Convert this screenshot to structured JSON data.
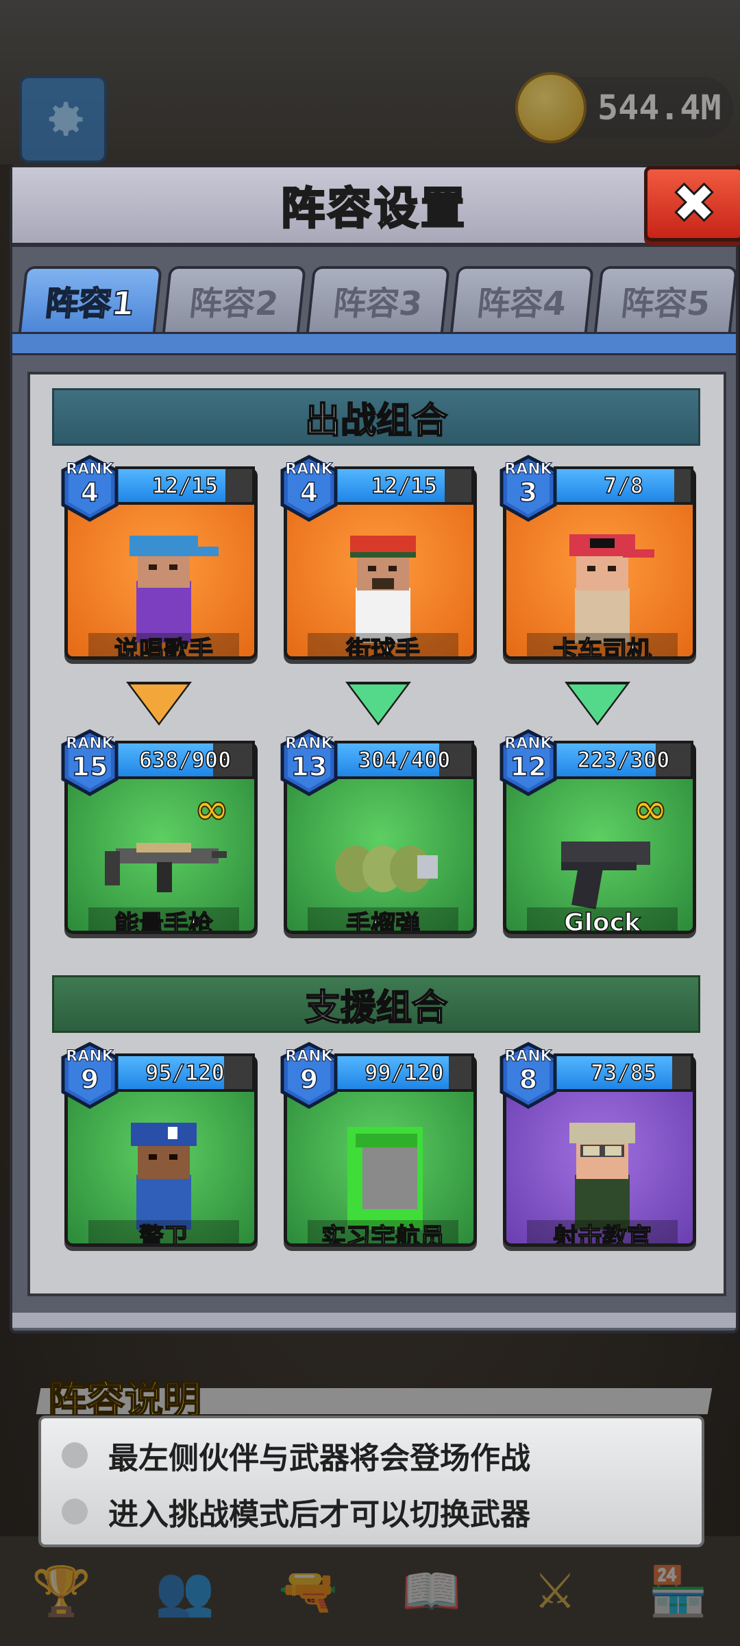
{
  "hud": {
    "coins": "544.4M"
  },
  "dialog": {
    "title": "阵容设置",
    "close_label": "✖",
    "tabs": [
      {
        "label": "阵容1",
        "active": true
      },
      {
        "label": "阵容2",
        "active": false
      },
      {
        "label": "阵容3",
        "active": false
      },
      {
        "label": "阵容4",
        "active": false
      },
      {
        "label": "阵容5",
        "active": false
      }
    ]
  },
  "battle_section": {
    "title": "出战组合",
    "partners": [
      {
        "rank_label": "RANK",
        "rank": "4",
        "progress": "12/15",
        "fill": 0.8,
        "name": "说唱歌手",
        "bg": "orange",
        "art": "rapper"
      },
      {
        "rank_label": "RANK",
        "rank": "4",
        "progress": "12/15",
        "fill": 0.8,
        "name": "街球手",
        "bg": "orange",
        "art": "baller"
      },
      {
        "rank_label": "RANK",
        "rank": "3",
        "progress": "7/8",
        "fill": 0.875,
        "name": "卡车司机",
        "bg": "orange",
        "art": "trucker"
      }
    ],
    "arrows": [
      "orange",
      "green",
      "green"
    ],
    "weapons": [
      {
        "rank_label": "RANK",
        "rank": "15",
        "progress": "638/900",
        "fill": 0.71,
        "name": "能量手枪",
        "bg": "green",
        "infinity": "∞",
        "art": "smg"
      },
      {
        "rank_label": "RANK",
        "rank": "13",
        "progress": "304/400",
        "fill": 0.76,
        "name": "手榴弹",
        "bg": "green",
        "infinity": "",
        "art": "grenade"
      },
      {
        "rank_label": "RANK",
        "rank": "12",
        "progress": "223/300",
        "fill": 0.74,
        "name": "Glock",
        "bg": "green",
        "infinity": "∞",
        "art": "pistol"
      }
    ]
  },
  "support_section": {
    "title": "支援组合",
    "partners": [
      {
        "rank_label": "RANK",
        "rank": "9",
        "progress": "95/120",
        "fill": 0.79,
        "name": "警卫",
        "bg": "green",
        "art": "guard"
      },
      {
        "rank_label": "RANK",
        "rank": "9",
        "progress": "99/120",
        "fill": 0.83,
        "name": "实习宇航员",
        "bg": "green",
        "art": "astronaut"
      },
      {
        "rank_label": "RANK",
        "rank": "8",
        "progress": "73/85",
        "fill": 0.86,
        "name": "射击教官",
        "bg": "purple",
        "art": "instructor"
      }
    ]
  },
  "explanation": {
    "title": "阵容说明",
    "items": [
      "最左侧伙伴与武器将会登场作战",
      "进入挑战模式后才可以切换武器"
    ]
  },
  "colors": {
    "tab_active": "#5b93e0",
    "progress_fill": "#2b8ef0",
    "card_orange": "#f07a22",
    "card_green": "#3aa646",
    "card_purple": "#8050c8",
    "close_red": "#d83020",
    "exp_title": "#f7cc46"
  }
}
